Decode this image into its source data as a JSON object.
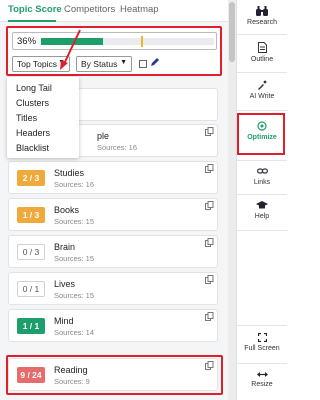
{
  "tabs": [
    {
      "label": "Topic Score",
      "active": true
    },
    {
      "label": "Competitors",
      "active": false
    },
    {
      "label": "Heatmap",
      "active": false
    }
  ],
  "score": {
    "percent_label": "36%",
    "progress_fraction": 0.36,
    "target_fraction": 0.58,
    "fill_color": "#1d9e6b",
    "marker_color": "#f0b429"
  },
  "filters": {
    "topics_select": "Top Topics",
    "status_select": "By Status"
  },
  "dropdown": {
    "items": [
      "Long Tail",
      "Clusters",
      "Titles",
      "Headers",
      "Blacklist"
    ]
  },
  "rows": [
    {
      "badge": "",
      "title": "",
      "sources": "",
      "partial_text": "..."
    },
    {
      "badge": "",
      "title": "ple",
      "sources": "Sources: 16",
      "partial_text": ""
    },
    {
      "badge": "2 / 3",
      "badge_style": "orange",
      "title": "Studies",
      "sources": "Sources: 16"
    },
    {
      "badge": "1 / 3",
      "badge_style": "orange",
      "title": "Books",
      "sources": "Sources: 15"
    },
    {
      "badge": "0 / 3",
      "badge_style": "grey",
      "title": "Brain",
      "sources": "Sources: 15"
    },
    {
      "badge": "0 / 1",
      "badge_style": "grey",
      "title": "Lives",
      "sources": "Sources: 15"
    },
    {
      "badge": "1 / 1",
      "badge_style": "green",
      "title": "Mind",
      "sources": "Sources: 14"
    },
    {
      "badge": "9 / 24",
      "badge_style": "red",
      "title": "Reading",
      "sources": "Sources: 9"
    }
  ],
  "sidebar": {
    "items": [
      {
        "label": "Research",
        "icon": "binoculars-icon"
      },
      {
        "label": "Outline",
        "icon": "document-icon"
      },
      {
        "label": "AI Write",
        "icon": "magic-pen-icon"
      },
      {
        "label": "Optimize",
        "icon": "target-icon",
        "active": true
      },
      {
        "label": "Links",
        "icon": "link-icon"
      },
      {
        "label": "Help",
        "icon": "graduation-cap-icon"
      },
      {
        "label": "Full Screen",
        "icon": "fullscreen-icon"
      },
      {
        "label": "Resize",
        "icon": "resize-icon"
      }
    ],
    "accent": "#1f9e6a"
  },
  "highlight_color": "#e01f2d"
}
